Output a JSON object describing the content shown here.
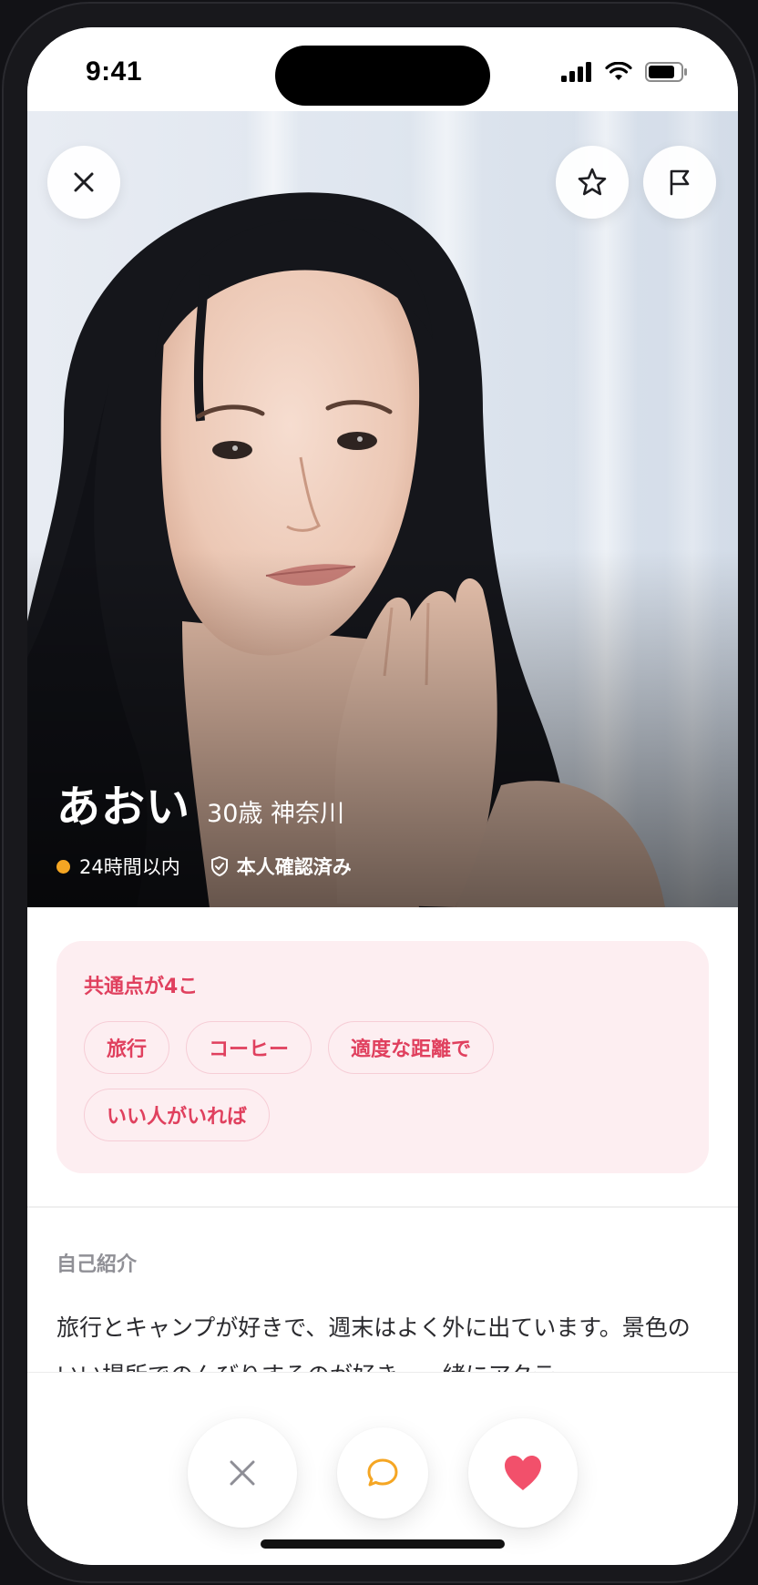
{
  "status_bar": {
    "time": "9:41"
  },
  "hero": {
    "close_icon": "close-icon",
    "favorite_icon": "star-icon",
    "report_icon": "flag-icon"
  },
  "profile": {
    "name": "あおい",
    "age_location": "30歳 神奈川",
    "online_status": "24時間以内",
    "online_color": "#f5a623",
    "verified_label": "本人確認済み"
  },
  "common": {
    "title": "共通点が4こ",
    "tags": [
      "旅行",
      "コーヒー",
      "適度な距離で",
      "いい人がいれば"
    ],
    "accent": "#e0405e",
    "card_bg": "#fdeef1"
  },
  "intro": {
    "label": "自己紹介",
    "text": "旅行とキャンプが好きで、週末はよく外に出ています。景色のいい場所でのんびりするのが好き。一緒にアクテ"
  },
  "actions": {
    "pass_icon": "close-icon",
    "message_icon": "chat-bubble-icon",
    "like_icon": "heart-icon",
    "like_color": "#f2506b",
    "message_color": "#f5a623"
  }
}
